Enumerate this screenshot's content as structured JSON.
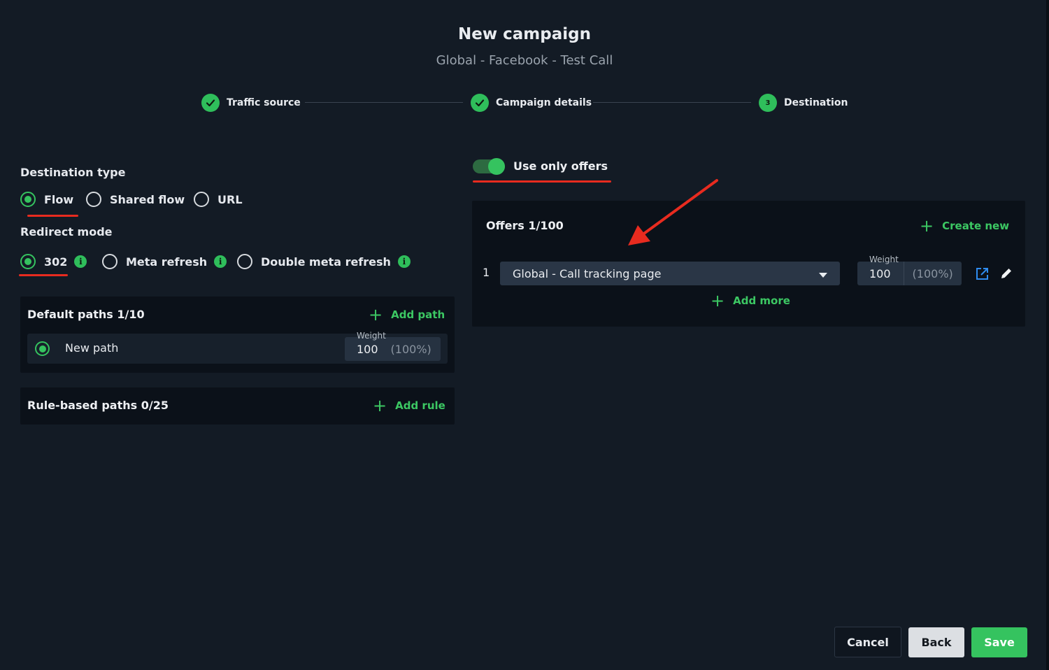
{
  "header": {
    "title": "New campaign",
    "subtitle": "Global - Facebook - Test Call"
  },
  "stepper": {
    "steps": [
      {
        "label": "Traffic source",
        "state": "done"
      },
      {
        "label": "Campaign details",
        "state": "done"
      },
      {
        "label": "Destination",
        "state": "active",
        "number": "3"
      }
    ]
  },
  "destination_type": {
    "label": "Destination type",
    "options": [
      {
        "label": "Flow",
        "selected": true
      },
      {
        "label": "Shared flow",
        "selected": false
      },
      {
        "label": "URL",
        "selected": false
      }
    ]
  },
  "redirect_mode": {
    "label": "Redirect mode",
    "options": [
      {
        "label": "302",
        "selected": true
      },
      {
        "label": "Meta refresh",
        "selected": false
      },
      {
        "label": "Double meta refresh",
        "selected": false
      }
    ],
    "info_glyph": "i"
  },
  "default_paths": {
    "title": "Default paths 1/10",
    "add_label": "Add path",
    "paths": [
      {
        "name": "New path",
        "weight_caption": "Weight",
        "weight": "100",
        "percent": "(100%)"
      }
    ]
  },
  "rule_paths": {
    "title": "Rule-based paths 0/25",
    "add_label": "Add rule"
  },
  "offers_toggle": {
    "label": "Use only offers",
    "on": true
  },
  "offers": {
    "title": "Offers 1/100",
    "create_label": "Create new",
    "items": [
      {
        "index": "1",
        "name": "Global - Call tracking page",
        "weight_caption": "Weight",
        "weight": "100",
        "percent": "(100%)"
      }
    ],
    "add_more_label": "Add more"
  },
  "footer": {
    "cancel_label": "Cancel",
    "back_label": "Back",
    "save_label": "Save"
  },
  "colors": {
    "background": "#131b25",
    "panel": "#0b1119",
    "accent_green": "#35c35f",
    "annotation_red": "#e82b1f",
    "link_blue": "#2f8cf0"
  },
  "icons": [
    "check-icon",
    "info-icon",
    "plus-icon",
    "caret-down-icon",
    "external-link-icon",
    "pencil-icon",
    "arrow-annotation"
  ]
}
